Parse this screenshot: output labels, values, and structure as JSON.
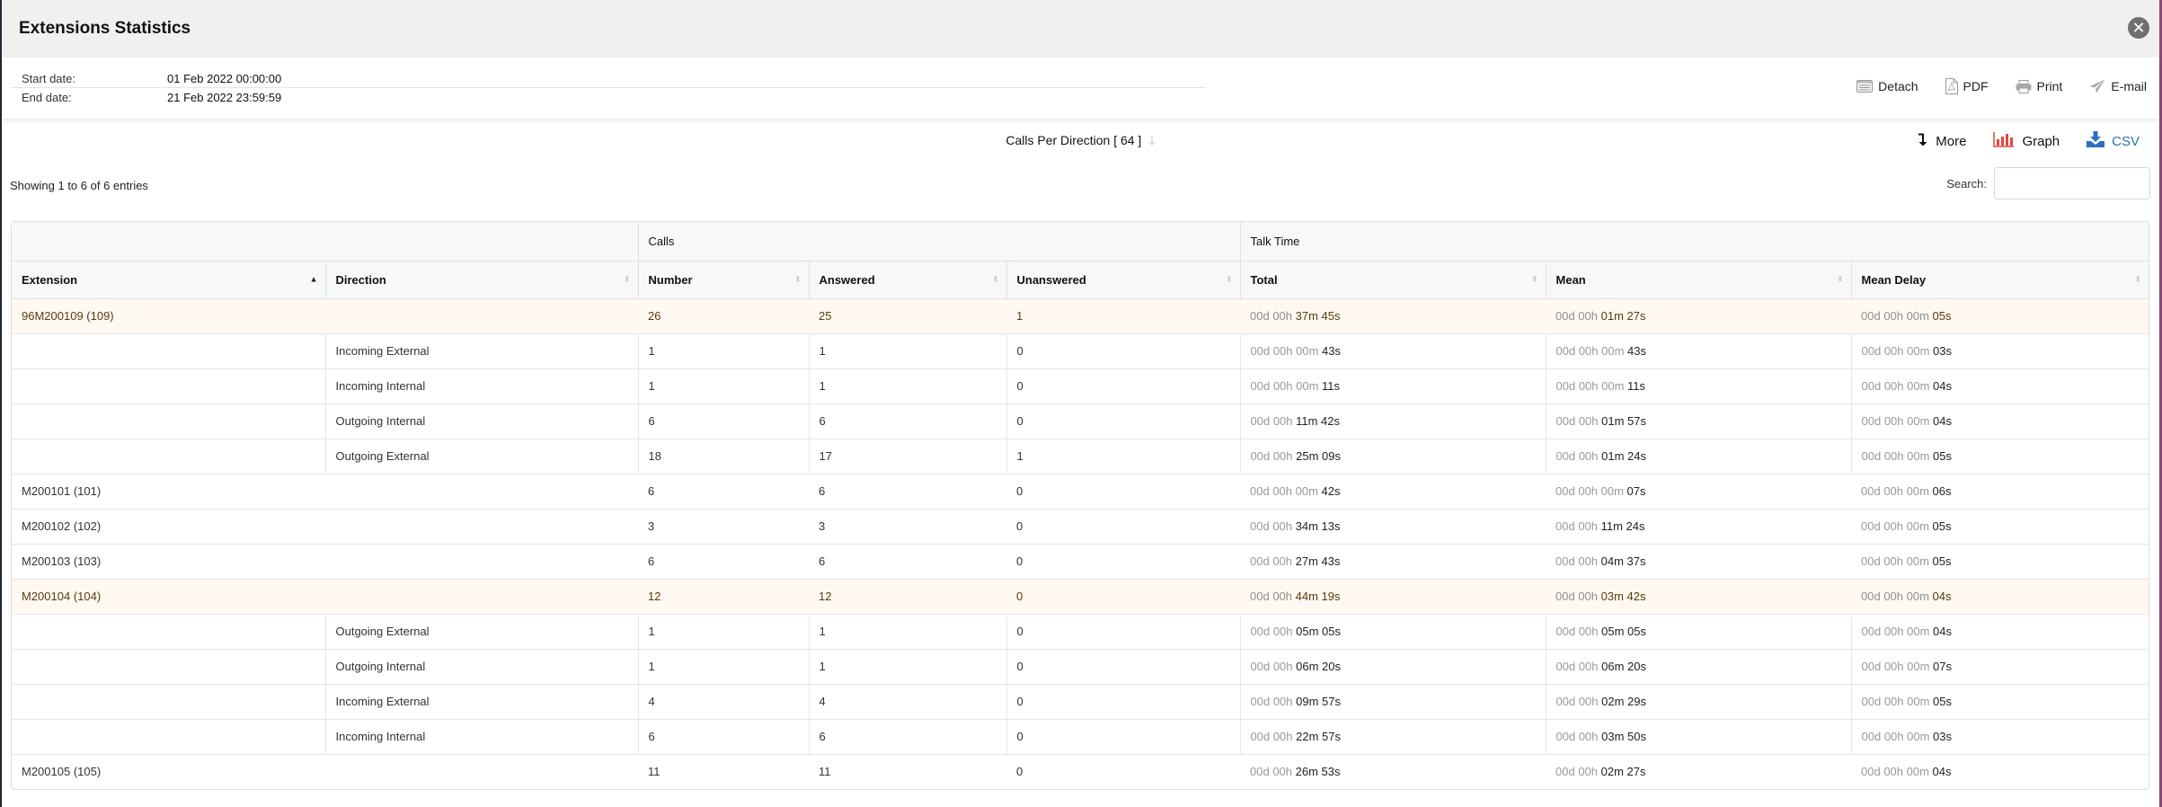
{
  "window": {
    "title": "Extensions Statistics",
    "close_icon": "close-circle-icon"
  },
  "info": {
    "start_label": "Start date:",
    "start_value": "01 Feb 2022 00:00:00",
    "end_label": "End date:",
    "end_value": "21 Feb 2022 23:59:59"
  },
  "actions": {
    "detach": "Detach",
    "pdf": "PDF",
    "print": "Print",
    "email": "E-mail"
  },
  "report": {
    "title": "Calls Per Direction [ 64 ]",
    "more": "More",
    "graph": "Graph",
    "csv": "CSV"
  },
  "colors": {
    "graph_icon": "#e2463f",
    "csv": "#2b6fbf",
    "expanded_row_bg": "#fff9f1",
    "expanded_row_text": "#5a3a0e"
  },
  "list": {
    "showing": "Showing 1 to 6 of 6 entries",
    "search_label": "Search:",
    "search_value": ""
  },
  "table": {
    "groups": {
      "calls": "Calls",
      "talk_time": "Talk Time"
    },
    "columns": [
      "Extension",
      "Direction",
      "Number",
      "Answered",
      "Unanswered",
      "Total",
      "Mean",
      "Mean Delay"
    ],
    "rows": [
      {
        "type": "parent",
        "expanded": true,
        "extension": "96M200109 (109)",
        "direction": "",
        "number": "26",
        "answered": "25",
        "unanswered": "1",
        "total": [
          "00d 00h ",
          "37m 45s"
        ],
        "mean": [
          "00d 00h ",
          "01m 27s"
        ],
        "delay": [
          "00d 00h 00m ",
          "05s"
        ]
      },
      {
        "type": "child",
        "extension": "",
        "direction": "Incoming External",
        "number": "1",
        "answered": "1",
        "unanswered": "0",
        "total": [
          "00d 00h 00m ",
          "43s"
        ],
        "mean": [
          "00d 00h 00m ",
          "43s"
        ],
        "delay": [
          "00d 00h 00m ",
          "03s"
        ]
      },
      {
        "type": "child",
        "extension": "",
        "direction": "Incoming Internal",
        "number": "1",
        "answered": "1",
        "unanswered": "0",
        "total": [
          "00d 00h 00m ",
          "11s"
        ],
        "mean": [
          "00d 00h 00m ",
          "11s"
        ],
        "delay": [
          "00d 00h 00m ",
          "04s"
        ]
      },
      {
        "type": "child",
        "extension": "",
        "direction": "Outgoing Internal",
        "number": "6",
        "answered": "6",
        "unanswered": "0",
        "total": [
          "00d 00h ",
          "11m 42s"
        ],
        "mean": [
          "00d 00h ",
          "01m 57s"
        ],
        "delay": [
          "00d 00h 00m ",
          "04s"
        ]
      },
      {
        "type": "child",
        "extension": "",
        "direction": "Outgoing External",
        "number": "18",
        "answered": "17",
        "unanswered": "1",
        "total": [
          "00d 00h ",
          "25m 09s"
        ],
        "mean": [
          "00d 00h ",
          "01m 24s"
        ],
        "delay": [
          "00d 00h 00m ",
          "05s"
        ]
      },
      {
        "type": "parent",
        "expanded": false,
        "extension": "M200101 (101)",
        "direction": "",
        "number": "6",
        "answered": "6",
        "unanswered": "0",
        "total": [
          "00d 00h 00m ",
          "42s"
        ],
        "mean": [
          "00d 00h 00m ",
          "07s"
        ],
        "delay": [
          "00d 00h 00m ",
          "06s"
        ]
      },
      {
        "type": "parent",
        "expanded": false,
        "extension": "M200102 (102)",
        "direction": "",
        "number": "3",
        "answered": "3",
        "unanswered": "0",
        "total": [
          "00d 00h ",
          "34m 13s"
        ],
        "mean": [
          "00d 00h ",
          "11m 24s"
        ],
        "delay": [
          "00d 00h 00m ",
          "05s"
        ]
      },
      {
        "type": "parent",
        "expanded": false,
        "extension": "M200103 (103)",
        "direction": "",
        "number": "6",
        "answered": "6",
        "unanswered": "0",
        "total": [
          "00d 00h ",
          "27m 43s"
        ],
        "mean": [
          "00d 00h ",
          "04m 37s"
        ],
        "delay": [
          "00d 00h 00m ",
          "05s"
        ]
      },
      {
        "type": "parent",
        "expanded": true,
        "extension": "M200104 (104)",
        "direction": "",
        "number": "12",
        "answered": "12",
        "unanswered": "0",
        "total": [
          "00d 00h ",
          "44m 19s"
        ],
        "mean": [
          "00d 00h ",
          "03m 42s"
        ],
        "delay": [
          "00d 00h 00m ",
          "04s"
        ]
      },
      {
        "type": "child",
        "extension": "",
        "direction": "Outgoing External",
        "number": "1",
        "answered": "1",
        "unanswered": "0",
        "total": [
          "00d 00h ",
          "05m 05s"
        ],
        "mean": [
          "00d 00h ",
          "05m 05s"
        ],
        "delay": [
          "00d 00h 00m ",
          "04s"
        ]
      },
      {
        "type": "child",
        "extension": "",
        "direction": "Outgoing Internal",
        "number": "1",
        "answered": "1",
        "unanswered": "0",
        "total": [
          "00d 00h ",
          "06m 20s"
        ],
        "mean": [
          "00d 00h ",
          "06m 20s"
        ],
        "delay": [
          "00d 00h 00m ",
          "07s"
        ]
      },
      {
        "type": "child",
        "extension": "",
        "direction": "Incoming External",
        "number": "4",
        "answered": "4",
        "unanswered": "0",
        "total": [
          "00d 00h ",
          "09m 57s"
        ],
        "mean": [
          "00d 00h ",
          "02m 29s"
        ],
        "delay": [
          "00d 00h 00m ",
          "05s"
        ]
      },
      {
        "type": "child",
        "extension": "",
        "direction": "Incoming Internal",
        "number": "6",
        "answered": "6",
        "unanswered": "0",
        "total": [
          "00d 00h ",
          "22m 57s"
        ],
        "mean": [
          "00d 00h ",
          "03m 50s"
        ],
        "delay": [
          "00d 00h 00m ",
          "03s"
        ]
      },
      {
        "type": "parent",
        "expanded": false,
        "extension": "M200105 (105)",
        "direction": "",
        "number": "11",
        "answered": "11",
        "unanswered": "0",
        "total": [
          "00d 00h ",
          "26m 53s"
        ],
        "mean": [
          "00d 00h ",
          "02m 27s"
        ],
        "delay": [
          "00d 00h 00m ",
          "04s"
        ]
      }
    ]
  }
}
